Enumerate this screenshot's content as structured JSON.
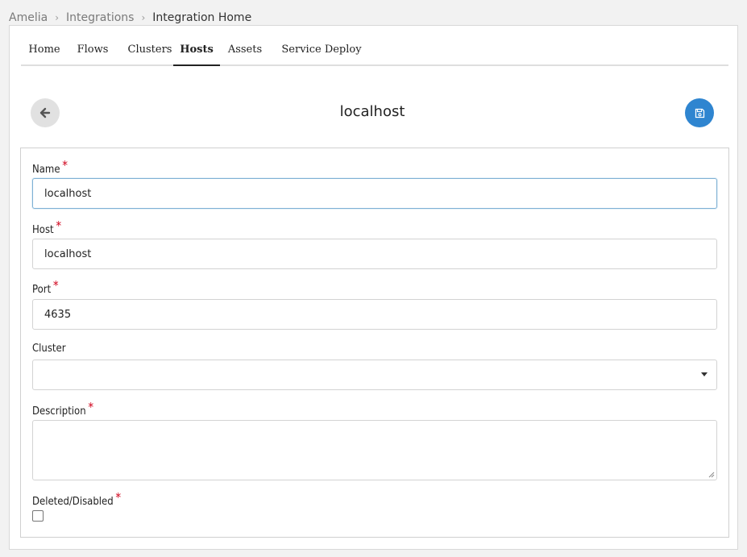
{
  "breadcrumb": {
    "items": [
      "Amelia",
      "Integrations",
      "Integration Home"
    ],
    "separator": "›"
  },
  "tabs": [
    {
      "label": "Home",
      "active": false
    },
    {
      "label": "Flows",
      "active": false
    },
    {
      "label": "Clusters",
      "active": false
    },
    {
      "label": "Hosts",
      "active": true
    },
    {
      "label": "Assets",
      "active": false
    },
    {
      "label": "Service Deploy",
      "active": false
    }
  ],
  "header": {
    "title": "localhost",
    "back_icon": "arrow-left-icon",
    "save_icon": "floppy-disk-icon"
  },
  "form": {
    "required_mark": "*",
    "name": {
      "label": "Name",
      "value": "localhost",
      "required": true
    },
    "host": {
      "label": "Host",
      "value": "localhost",
      "required": true
    },
    "port": {
      "label": "Port",
      "value": "4635",
      "required": true
    },
    "cluster": {
      "label": "Cluster",
      "value": "",
      "required": false
    },
    "description": {
      "label": "Description",
      "value": "",
      "required": true
    },
    "deleted": {
      "label": "Deleted/Disabled",
      "checked": false,
      "required": true
    }
  },
  "colors": {
    "accent": "#2f85d0",
    "required": "#d0021b",
    "background": "#f2f2f2"
  }
}
